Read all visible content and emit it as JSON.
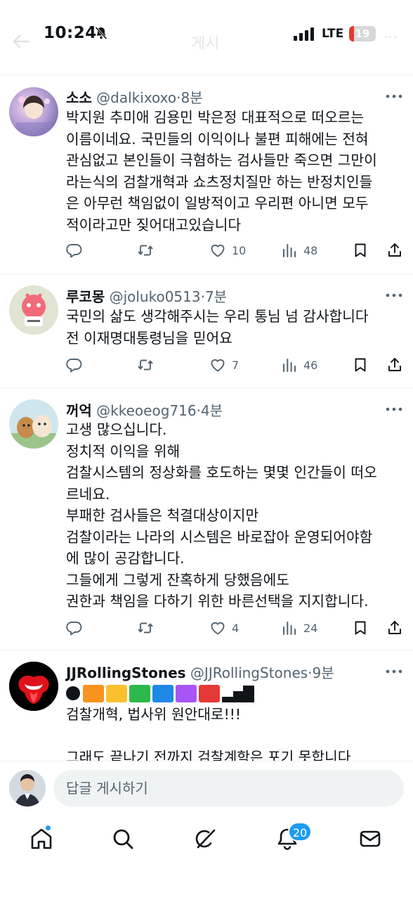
{
  "status_bar": {
    "time": "10:24",
    "network": "LTE",
    "battery_level": "19",
    "battery_fraction": 0.19,
    "ghost_title": "게시"
  },
  "tweets": [
    {
      "name": "소소",
      "handle": "@dalkixoxo",
      "separator": "·",
      "time": "8분",
      "text": "박지원 추미애 김용민 박은정 대표적으로 떠오르는\n이름이네요. 국민들의 이익이나 불편 피해에는 전혀\n관심없고 본인들이 극혐하는 검사들만 죽으면 그만이\n라는식의 검찰개혁과 쇼츠정치질만 하는 반정치인들\n은 아무런 책임없이 일방적이고 우리편 아니면 모두\n적이라고만 짖어대고있습니다",
      "replies": "",
      "retweets": "",
      "likes": "10",
      "views": "48"
    },
    {
      "name": "루코몽",
      "handle": "@joluko0513",
      "separator": "·",
      "time": "7분",
      "text": "국민의 삶도 생각해주시는 우리 통님 넘 감사합니다\n전 이재명대통령님을 믿어요",
      "replies": "",
      "retweets": "",
      "likes": "7",
      "views": "46"
    },
    {
      "name": "꺼억",
      "handle": "@kkeoeog716",
      "separator": "·",
      "time": "4분",
      "text": "고생 많으십니다.\n정치적 이익을 위해\n검찰시스템의 정상화를 호도하는 몇몇 인간들이 떠오\n르네요.\n부패한 검사들은 척결대상이지만\n검찰이라는 나라의 시스템은 바로잡아 운영되어야함\n에 많이 공감합니다.\n그들에게 그렇게 잔혹하게 당했음에도\n권한과 책임을 다하기 위한 바른선택을 지지합니다.",
      "replies": "",
      "retweets": "",
      "likes": "4",
      "views": "24"
    },
    {
      "name": "JJRollingStones",
      "handle": "@JJRollingStones",
      "separator": "·",
      "time": "9분",
      "emoji_colors": [
        "#f7931e",
        "#fbc02d",
        "#2db84d",
        "#1e88e5",
        "#a855f7",
        "#e53935"
      ],
      "text": "검찰개혁, 법사위 원안대로!!!\n\n그래도 끝나기 전까지 검찰계학은 포기 못합니다"
    }
  ],
  "reply_bar": {
    "placeholder": "답글 게시하기"
  },
  "bottom_nav": {
    "items": [
      "home-icon",
      "search-icon",
      "grok-icon",
      "notifications-icon",
      "messages-icon"
    ],
    "notification_count": "20"
  },
  "colors": {
    "accent": "#1d9bf0",
    "secondary_text": "#536471",
    "primary_text": "#0f1419",
    "divider": "#eff3f4"
  }
}
